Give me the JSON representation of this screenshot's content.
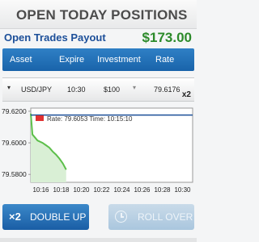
{
  "title": "OPEN TODAY POSITIONS",
  "payout": {
    "label": "Open Trades Payout",
    "value": "$173.00"
  },
  "table": {
    "headers": [
      "Asset",
      "Expire",
      "Investment",
      "Rate"
    ],
    "row": {
      "asset": "USD/JPY",
      "expire": "10:30",
      "investment": "$100",
      "rate": "79.6176",
      "multiplier": "x2"
    }
  },
  "chart_data": {
    "type": "line",
    "y_ticks": [
      "79.6200",
      "79.6000",
      "79.5800"
    ],
    "x_ticks": [
      "10:16",
      "10:18",
      "10:20",
      "10:22",
      "10:24",
      "10:26",
      "10:28",
      "10:30"
    ],
    "ylim": [
      79.575,
      79.622
    ],
    "tooltip": "Rate: 79.6053 Time: 10:15:10",
    "rate_line": 79.6176,
    "series": [
      {
        "x": [
          "10:15:00",
          "10:15:10",
          "10:15:40",
          "10:16:10",
          "10:16:30",
          "10:16:50",
          "10:17:10",
          "10:17:30",
          "10:17:50",
          "10:18:10",
          "10:18:30"
        ],
        "values": [
          79.6185,
          79.6053,
          79.6015,
          79.6,
          79.5985,
          79.597,
          79.5945,
          79.5925,
          79.59,
          79.587,
          79.583
        ]
      }
    ],
    "colors": {
      "line": "#5cbf4a",
      "area": "#d9efd5",
      "rate_line": "#1c4f99",
      "tooltip_marker": "#e03131"
    }
  },
  "buttons": {
    "double_multiplier": "×2",
    "double": "DOUBLE UP",
    "rollover": "ROLL OVER"
  }
}
